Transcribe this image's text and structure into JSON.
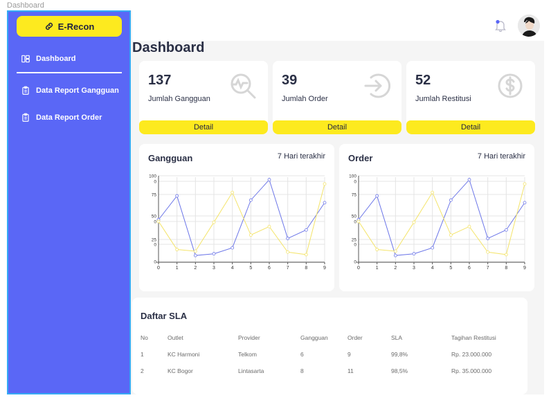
{
  "frame_label": "Dashboard",
  "brand": {
    "name": "E-Recon"
  },
  "sidebar": {
    "items": [
      {
        "label": "Dashboard",
        "icon": "layout-icon"
      },
      {
        "label": "Data Report Gangguan",
        "icon": "clipboard-icon"
      },
      {
        "label": "Data Report Order",
        "icon": "clipboard-icon"
      }
    ]
  },
  "header": {
    "title": "Dashboard"
  },
  "stats": [
    {
      "value": "137",
      "label": "Jumlah Gangguan",
      "button": "Detail",
      "icon": "search-pulse-icon"
    },
    {
      "value": "39",
      "label": "Jumlah Order",
      "button": "Detail",
      "icon": "arrow-in-icon"
    },
    {
      "value": "52",
      "label": "Jumlah Restitusi",
      "button": "Detail",
      "icon": "dollar-icon"
    }
  ],
  "charts": {
    "gangguan": {
      "title": "Gangguan",
      "range": "7 Hari terakhir"
    },
    "order": {
      "title": "Order",
      "range": "7 Hari terakhir"
    }
  },
  "colors": {
    "sidebar": "#5a67f6",
    "accent": "#fdea1f",
    "series_blue": "#6c76e8",
    "series_yellow": "#f4e46a"
  },
  "chart_data": [
    {
      "type": "line",
      "x": [
        0,
        1,
        2,
        3,
        4,
        5,
        6,
        7,
        8,
        9
      ],
      "series": [
        {
          "values": [
            50,
            78,
            8,
            10,
            17,
            73,
            97,
            28,
            38,
            70
          ]
        },
        {
          "values": [
            48,
            15,
            13,
            47,
            82,
            32,
            42,
            12,
            9,
            92
          ]
        }
      ],
      "y_ticks": [
        "100",
        "0",
        "75",
        "50",
        "0",
        "25",
        "0",
        "0"
      ],
      "ylim": [
        0,
        100
      ],
      "grid": true
    },
    {
      "type": "line",
      "x": [
        0,
        1,
        2,
        3,
        4,
        5,
        6,
        7,
        8,
        9
      ],
      "series": [
        {
          "values": [
            50,
            78,
            8,
            10,
            17,
            73,
            97,
            28,
            38,
            70
          ]
        },
        {
          "values": [
            48,
            15,
            13,
            47,
            82,
            32,
            42,
            12,
            9,
            92
          ]
        }
      ],
      "y_ticks": [
        "100",
        "0",
        "75",
        "50",
        "0",
        "25",
        "0",
        "0"
      ],
      "ylim": [
        0,
        100
      ],
      "grid": true
    }
  ],
  "sla": {
    "title": "Daftar SLA",
    "columns": [
      "No",
      "Outlet",
      "Provider",
      "Gangguan",
      "Order",
      "SLA",
      "Tagihan Restitusi"
    ],
    "rows": [
      [
        "1",
        "KC Harmoni",
        "Telkom",
        "6",
        "9",
        "99,8%",
        "Rp. 23.000.000"
      ],
      [
        "2",
        "KC Bogor",
        "Lintasarta",
        "8",
        "11",
        "98,5%",
        "Rp. 35.000.000"
      ]
    ]
  }
}
